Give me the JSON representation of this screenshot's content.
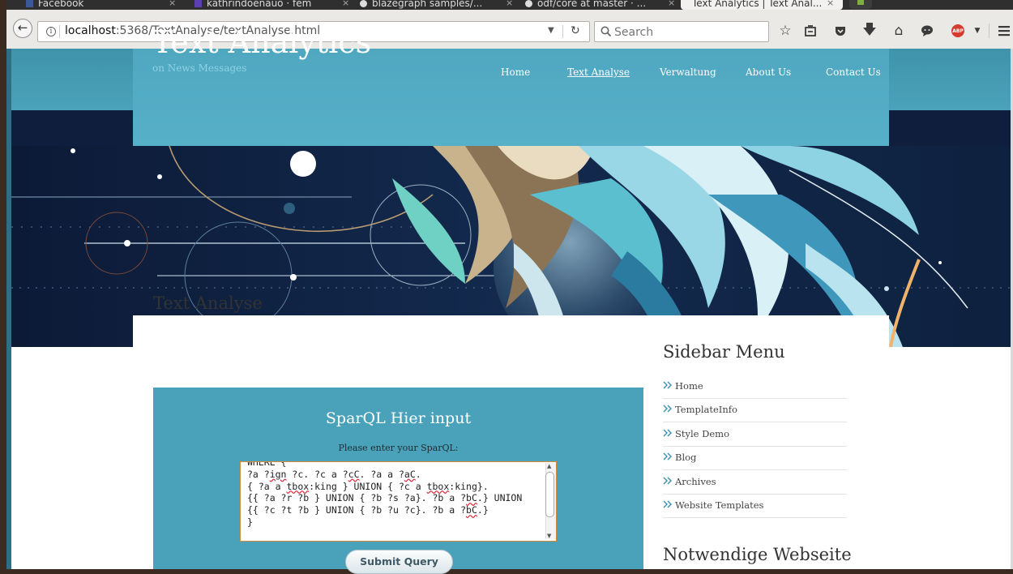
{
  "browser": {
    "tabs": [
      {
        "title": "Facebook",
        "active": false
      },
      {
        "title": "kathrindoenauo · fem",
        "active": false
      },
      {
        "title": "blazegraph samples/...",
        "active": false
      },
      {
        "title": "odf/core at master · ...",
        "active": false
      },
      {
        "title": "Text Analytics | Text Anal...",
        "active": true
      }
    ],
    "url_host": "localhost",
    "url_rest": ":5368/TextAnalyse/textAnalyse.html",
    "search_placeholder": "Search",
    "abp_label": "ABP",
    "colors": {
      "toolbar": "#ebe9e6",
      "tabstrip": "#2f2f2f"
    }
  },
  "site": {
    "title": "Text Analytics",
    "subtitle": "on News Messages",
    "nav": [
      {
        "label": "Home",
        "current": false
      },
      {
        "label": "Text Analyse",
        "current": true
      },
      {
        "label": "Verwaltung",
        "current": false
      },
      {
        "label": "About Us",
        "current": false
      },
      {
        "label": "Contact Us",
        "current": false
      }
    ],
    "colors": {
      "header": "#4aa3bb",
      "art_bg": "#0f1e3c"
    }
  },
  "main": {
    "heading": "Text Analyse",
    "form": {
      "title": "SparQL Hier input",
      "label": "Please enter your SparQL:",
      "query_lines": [
        "WHERE {",
        "?a ?ign ?c. ?c a ?cC. ?a a ?aC.",
        "{ ?a a tbox:king } UNION { ?c a tbox:king}.",
        "{{ ?a ?r ?b } UNION { ?b ?s ?a}. ?b a ?bC.} UNION",
        "{{ ?c ?t ?b } UNION { ?b ?u ?c}. ?b a ?bC.}",
        "}"
      ],
      "submit_label": "Submit Query",
      "colors": {
        "box": "#4aa2ba",
        "border": "#d98b3a"
      }
    }
  },
  "sidebar": {
    "heading": "Sidebar Menu",
    "items": [
      {
        "label": "Home"
      },
      {
        "label": "TemplateInfo"
      },
      {
        "label": "Style Demo"
      },
      {
        "label": "Blog"
      },
      {
        "label": "Archives"
      },
      {
        "label": "Website Templates"
      }
    ],
    "heading2": "Notwendige Webseite"
  }
}
